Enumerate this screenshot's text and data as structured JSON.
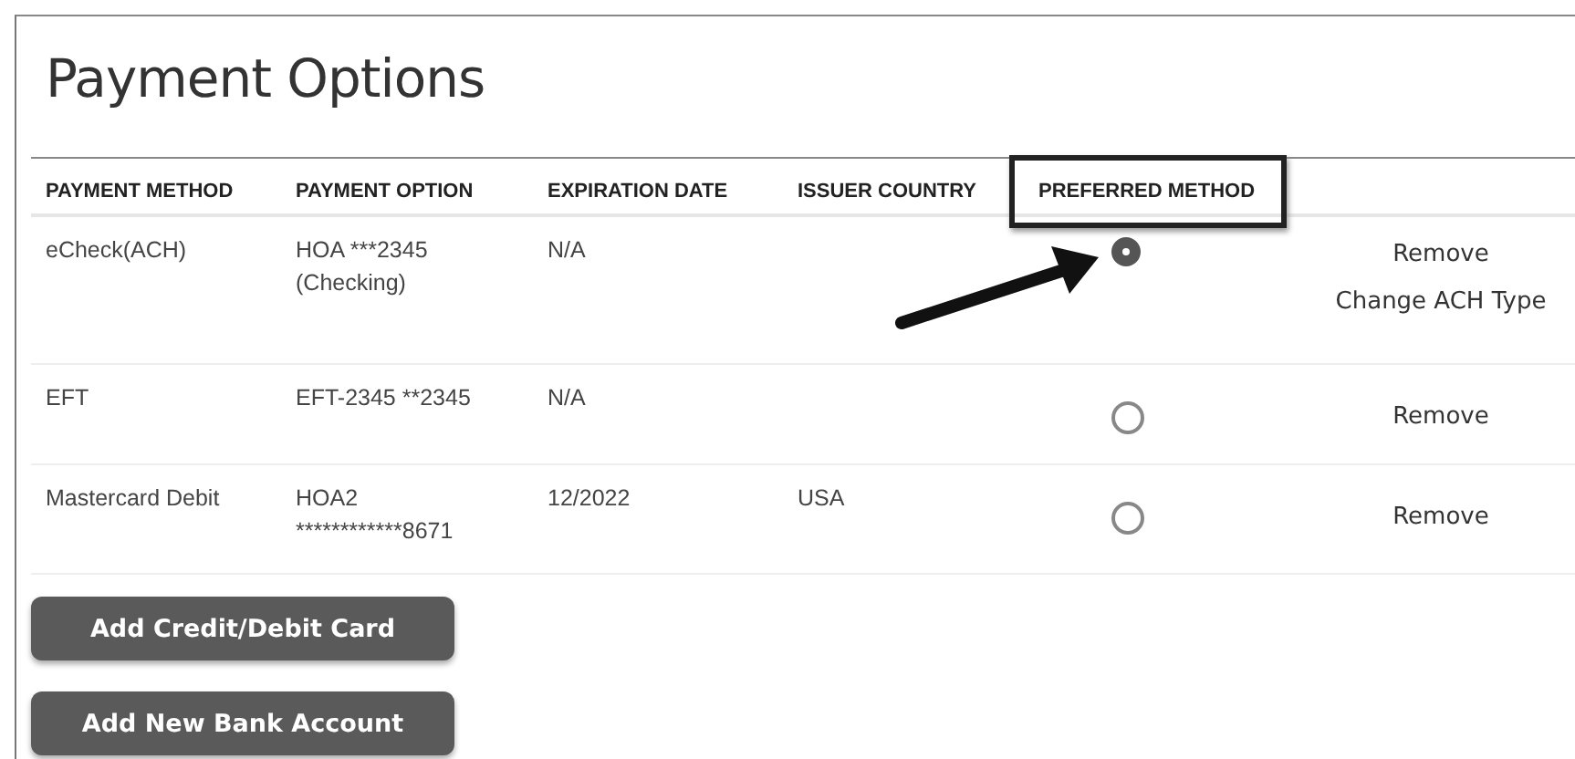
{
  "title": "Payment Options",
  "table": {
    "columns": [
      {
        "label": "PAYMENT METHOD",
        "highlighted": false
      },
      {
        "label": "PAYMENT OPTION",
        "highlighted": false
      },
      {
        "label": "EXPIRATION DATE",
        "highlighted": false
      },
      {
        "label": "ISSUER COUNTRY",
        "highlighted": false
      },
      {
        "label": "PREFERRED METHOD",
        "highlighted": true
      }
    ],
    "rows": [
      {
        "method": "eCheck(ACH)",
        "option": [
          "HOA ***2345",
          "(Checking)"
        ],
        "expiration": "N/A",
        "country": "",
        "selected": true,
        "actions": [
          "Remove",
          "Change ACH Type"
        ]
      },
      {
        "method": "EFT",
        "option": [
          "EFT-2345 **2345"
        ],
        "expiration": "N/A",
        "country": "",
        "selected": false,
        "actions": [
          "Remove"
        ]
      },
      {
        "method": "Mastercard Debit",
        "option": [
          "HOA2",
          "************8671"
        ],
        "expiration": "12/2022",
        "country": "USA",
        "selected": false,
        "actions": [
          "Remove"
        ]
      }
    ]
  },
  "buttons": [
    "Add Credit/Debit Card",
    "Add New Bank Account"
  ]
}
